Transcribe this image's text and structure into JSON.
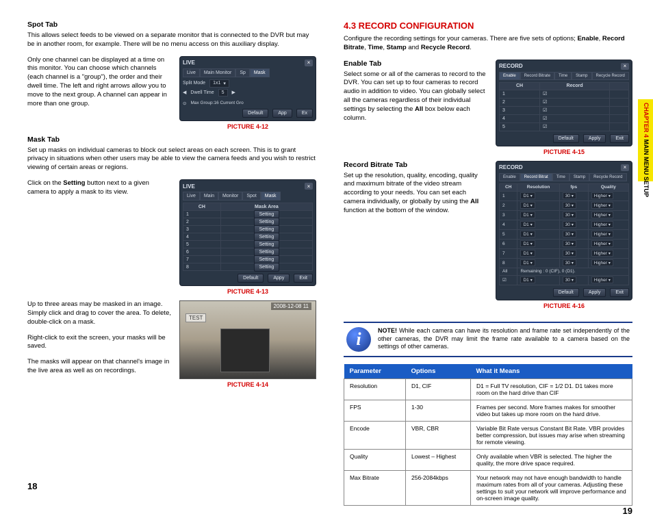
{
  "left": {
    "spot_tab_title": "Spot Tab",
    "spot_p1": "This allows select feeds to be viewed on a separate monitor that is connected to the DVR but may be in another room, for example. There will be no menu access on this auxiliary display.",
    "spot_p2": "Only one channel can be displayed at a time on this monitor. You can choose which channels (each channel is a \"group\"), the order and their dwell time. The left and right arrows allow you to move to the next group. A channel can appear in more than one group.",
    "fig12_caption": "PICTURE 4-12",
    "fig12": {
      "title": "LIVE",
      "tabs": [
        "Live",
        "Main Monitor",
        "Sp",
        "Mask"
      ],
      "row1_label": "Split Mode",
      "row1_value": "1x1",
      "row2_label": "Dwell Time",
      "row2_value": "5",
      "footer": "Max Group:16  Current Gro",
      "buttons": [
        "Default",
        "App",
        "Ex"
      ]
    },
    "mask_tab_title": "Mask Tab",
    "mask_p1": "Set up masks on individual cameras to block out select areas on each screen. This is to grant privacy in situations when other users may be able to view the camera feeds and you wish to restrict viewing of certain areas or regions.",
    "mask_p2a": "Click on the ",
    "mask_p2b": "Setting",
    "mask_p2c": " button next to a given camera to apply a mask to its view.",
    "fig13_caption": "PICTURE 4-13",
    "fig13": {
      "title": "LIVE",
      "tabs": [
        "Live",
        "Main",
        "Monitor",
        "Spot",
        "Mask"
      ],
      "col_ch": "CH",
      "col_mask": "Mask Area",
      "rows": [
        {
          "ch": "1",
          "btn": "Setting"
        },
        {
          "ch": "2",
          "btn": "Setting"
        },
        {
          "ch": "3",
          "btn": "Setting"
        },
        {
          "ch": "4",
          "btn": "Setting"
        },
        {
          "ch": "5",
          "btn": "Setting"
        },
        {
          "ch": "6",
          "btn": "Setting"
        },
        {
          "ch": "7",
          "btn": "Setting"
        },
        {
          "ch": "8",
          "btn": "Setting"
        }
      ],
      "buttons": [
        "Default",
        "Appy",
        "Exit"
      ]
    },
    "mask_p3": "Up to three areas may be masked in an image. Simply click and drag to cover the area. To delete, double-click on a mask.",
    "mask_p4": "Right-click to exit the screen, your masks will be saved.",
    "mask_p5": "The masks will appear on that channel's image in the live area as well as on recordings.",
    "fig14_caption": "PICTURE 4-14",
    "fig14_ts": "2008-12-08  11",
    "fig14_lbl": "TEST",
    "page_num": "18"
  },
  "right": {
    "heading": "4.3 RECORD CONFIGURATION",
    "intro_a": "Configure the recording settings for your cameras. There are five sets of options; ",
    "intro_b": "Enable",
    "intro_c": ", ",
    "intro_d": "Record Bitrate",
    "intro_e": ", ",
    "intro_f": "Time",
    "intro_g": ", ",
    "intro_h": "Stamp",
    "intro_i": " and ",
    "intro_j": "Recycle Record",
    "intro_k": ".",
    "enable_title": "Enable Tab",
    "enable_p_a": "Select some or all of the cameras to record to the DVR. You can set up to four cameras to record audio in addition to video. You can globally select all the cameras regardless of their individual settings by selecting the ",
    "enable_p_b": "All",
    "enable_p_c": " box below each column.",
    "fig15_caption": "PICTURE 4-15",
    "fig15": {
      "title": "RECORD",
      "tabs": [
        "Enable",
        "Record Bitrate",
        "Time",
        "Stamp",
        "Recycle Record"
      ],
      "cols": [
        "CH",
        "Record"
      ],
      "buttons": [
        "Default",
        "Apply",
        "Exit"
      ]
    },
    "bitrate_title": "Record Bitrate Tab",
    "bitrate_p_a": "Set up the resolution, quality, encoding, quality and maximum bitrate of the video stream according to your needs. You can set each camera individually, or globally by using the ",
    "bitrate_p_b": "All",
    "bitrate_p_c": " function at the bottom of the window.",
    "fig16_caption": "PICTURE 4-16",
    "fig16": {
      "title": "RECORD",
      "tabs": [
        "Enable",
        "Record Bitrat",
        "Time",
        "Stamp",
        "Recycle Record"
      ],
      "cols": [
        "CH",
        "Resolution",
        "fps",
        "Quality"
      ],
      "rows": [
        {
          "ch": "1",
          "res": "D1",
          "fps": "30",
          "q": "Higher"
        },
        {
          "ch": "2",
          "res": "D1",
          "fps": "30",
          "q": "Higher"
        },
        {
          "ch": "3",
          "res": "D1",
          "fps": "30",
          "q": "Higher"
        },
        {
          "ch": "4",
          "res": "D1",
          "fps": "30",
          "q": "Higher"
        },
        {
          "ch": "5",
          "res": "D1",
          "fps": "30",
          "q": "Higher"
        },
        {
          "ch": "6",
          "res": "D1",
          "fps": "30",
          "q": "Higher"
        },
        {
          "ch": "7",
          "res": "D1",
          "fps": "30",
          "q": "Higher"
        },
        {
          "ch": "8",
          "res": "D1",
          "fps": "30",
          "q": "Higher"
        }
      ],
      "all_label": "All",
      "remaining": "Remaining : 0 (CIF), 0 (D1).",
      "all_row": {
        "res": "D1",
        "fps": "30",
        "q": "Higher"
      },
      "buttons": [
        "Default",
        "Apply",
        "Exit"
      ]
    },
    "note_label": "NOTE!",
    "note_text": " While each camera can have its resolution and frame rate set independently of the other cameras, the DVR may limit the frame rate available to a camera based on the settings of other cameras.",
    "table": {
      "h1": "Parameter",
      "h2": "Options",
      "h3": "What it Means",
      "rows": [
        {
          "p": "Resolution",
          "o": "D1, CIF",
          "m": "D1 = Full TV resolution, CIF = 1/2 D1. D1 takes more room on the hard drive than CIF"
        },
        {
          "p": "FPS",
          "o": "1-30",
          "m": "Frames per second. More frames makes for smoother video but takes up more room on the hard drive."
        },
        {
          "p": "Encode",
          "o": "VBR, CBR",
          "m": "Variable Bit Rate versus Constant Bit Rate. VBR provides better compression, but issues may arise when streaming for remote viewing."
        },
        {
          "p": "Quality",
          "o": "Lowest – Highest",
          "m": "Only available when VBR is selected. The higher the quality, the more drive space required."
        },
        {
          "p": "Max Bitrate",
          "o": "256-2084kbps",
          "m": " Your network may not have enough bandwidth to handle maximum rates from all of your cameras. Adjusting these settings to suit your network will improve performance and on-screen image quality."
        }
      ]
    },
    "page_num": "19"
  },
  "sidebar": {
    "chapter": "CHAPTER 4 ",
    "title": "MAIN MENU SETUP"
  }
}
